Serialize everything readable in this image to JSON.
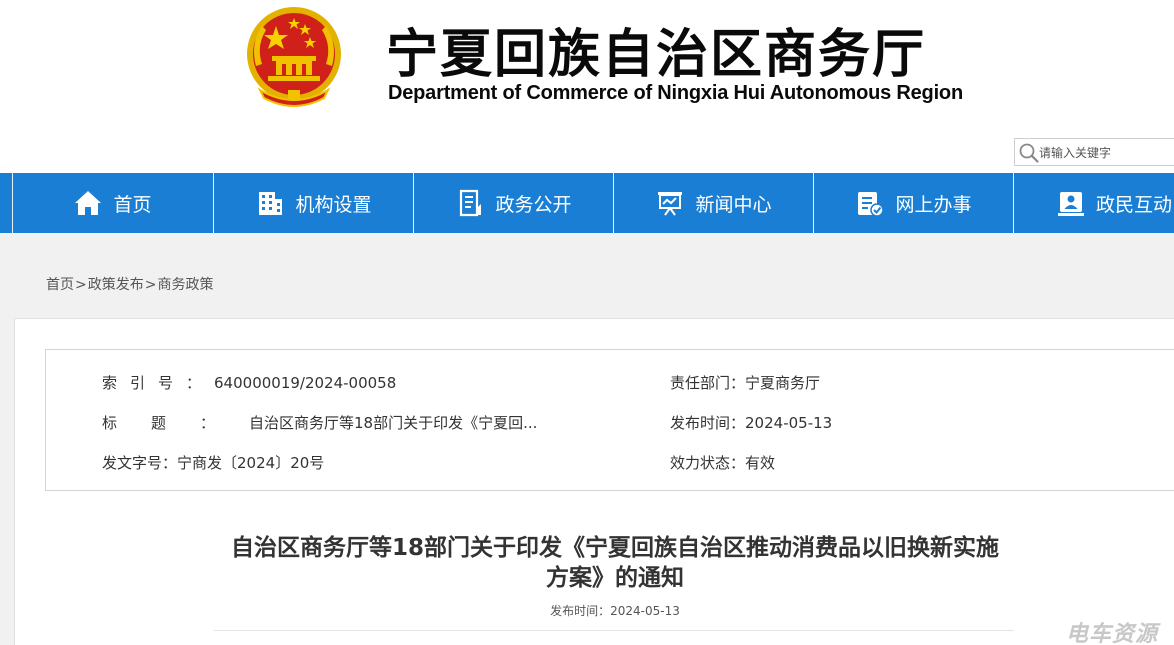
{
  "header": {
    "title_cn": "宁夏回族自治区商务厅",
    "title_en": "Department of Commerce of Ningxia Hui Autonomous Region",
    "emblem_icon": "national-emblem-icon"
  },
  "search": {
    "placeholder": "请输入关键字",
    "icon": "search-icon"
  },
  "nav": {
    "items": [
      {
        "label": "首页",
        "icon": "home-icon"
      },
      {
        "label": "机构设置",
        "icon": "building-icon"
      },
      {
        "label": "政务公开",
        "icon": "document-icon"
      },
      {
        "label": "新闻中心",
        "icon": "presentation-icon"
      },
      {
        "label": "网上办事",
        "icon": "form-edit-icon"
      },
      {
        "label": "政民互动",
        "icon": "people-icon"
      }
    ],
    "background": "#1a7fd4"
  },
  "breadcrumb": {
    "items": [
      "首页",
      "政策发布",
      "商务政策"
    ],
    "separator": ">"
  },
  "meta": {
    "index_label": "索引号：",
    "index_value": "640000019/2024-00058",
    "dept_label": "责任部门：",
    "dept_value": "宁夏商务厅",
    "title_label": "标题：",
    "title_value": "自治区商务厅等18部门关于印发《宁夏回...",
    "publish_label": "发布时间：",
    "publish_value": "2024-05-13",
    "doc_no_label": "发文字号：",
    "doc_no_value": "宁商发〔2024〕20号",
    "status_label": "效力状态：",
    "status_value": "有效"
  },
  "article": {
    "title_line1": "自治区商务厅等18部门关于印发《宁夏回族自治区推动消费品以旧换新实施",
    "title_line2": "方案》的通知",
    "date_text": "发布时间：2024-05-13"
  },
  "watermark": "电车资源",
  "colors": {
    "emblem_red": "#d0201a",
    "emblem_gold": "#f2c200",
    "grey_background": "#f1f1f1"
  }
}
